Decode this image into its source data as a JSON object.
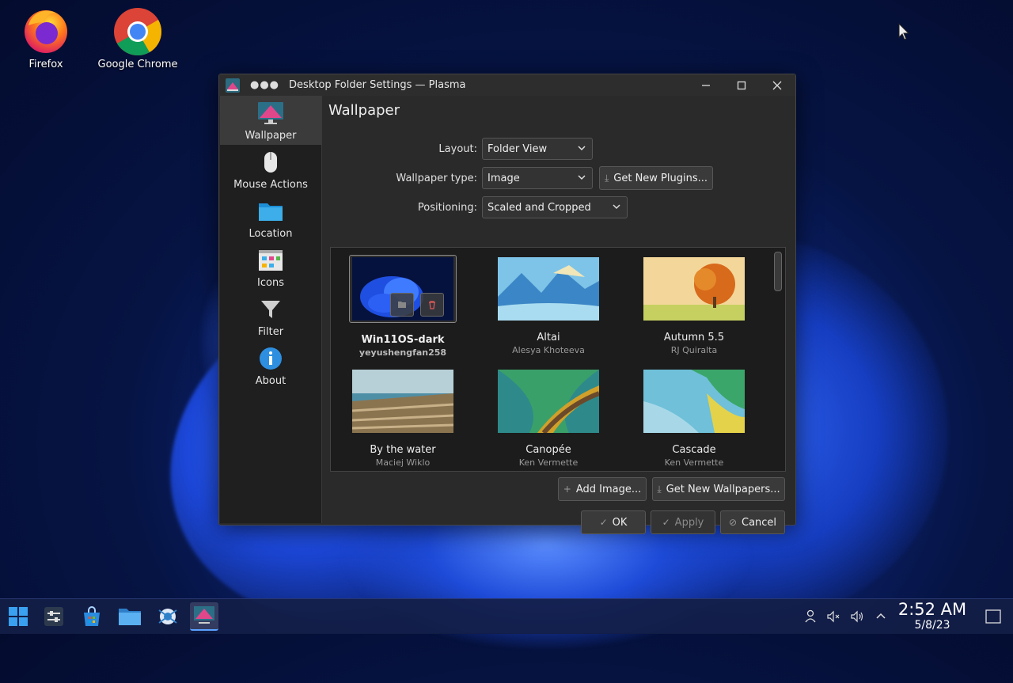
{
  "desktop": {
    "icons": [
      {
        "label": "Firefox"
      },
      {
        "label": "Google Chrome"
      }
    ]
  },
  "window": {
    "title": "Desktop Folder Settings — Plasma",
    "dots": "●●●"
  },
  "sidebar": {
    "items": [
      {
        "label": "Wallpaper",
        "icon": "monitor-icon",
        "active": true
      },
      {
        "label": "Mouse Actions",
        "icon": "mouse-icon"
      },
      {
        "label": "Location",
        "icon": "folder-icon"
      },
      {
        "label": "Icons",
        "icon": "icons-grid-icon"
      },
      {
        "label": "Filter",
        "icon": "funnel-icon"
      },
      {
        "label": "About",
        "icon": "info-icon"
      }
    ]
  },
  "page": {
    "title": "Wallpaper",
    "layout": {
      "label": "Layout:",
      "value": "Folder View"
    },
    "wallpaper_type": {
      "label": "Wallpaper type:",
      "value": "Image"
    },
    "get_new_plugins": "Get New Plugins...",
    "positioning": {
      "label": "Positioning:",
      "value": "Scaled and Cropped"
    },
    "wallpapers": [
      {
        "name": "Win11OS-dark",
        "author": "yeyushengfan258",
        "selected": true
      },
      {
        "name": "Altai",
        "author": "Alesya Khoteeva"
      },
      {
        "name": "Autumn 5.5",
        "author": "RJ Quiralta"
      },
      {
        "name": "By the water",
        "author": "Maciej Wiklo"
      },
      {
        "name": "Canopée",
        "author": "Ken Vermette"
      },
      {
        "name": "Cascade",
        "author": "Ken Vermette"
      }
    ],
    "add_image": "Add Image...",
    "get_new_wallpapers": "Get New Wallpapers...",
    "ok": "OK",
    "apply": "Apply",
    "cancel": "Cancel"
  },
  "taskbar": {
    "clock": {
      "time": "2:52 AM",
      "date": "5/8/23"
    }
  },
  "colors": {
    "accent": "#3daee9",
    "window_bg": "#2a2a2a"
  }
}
